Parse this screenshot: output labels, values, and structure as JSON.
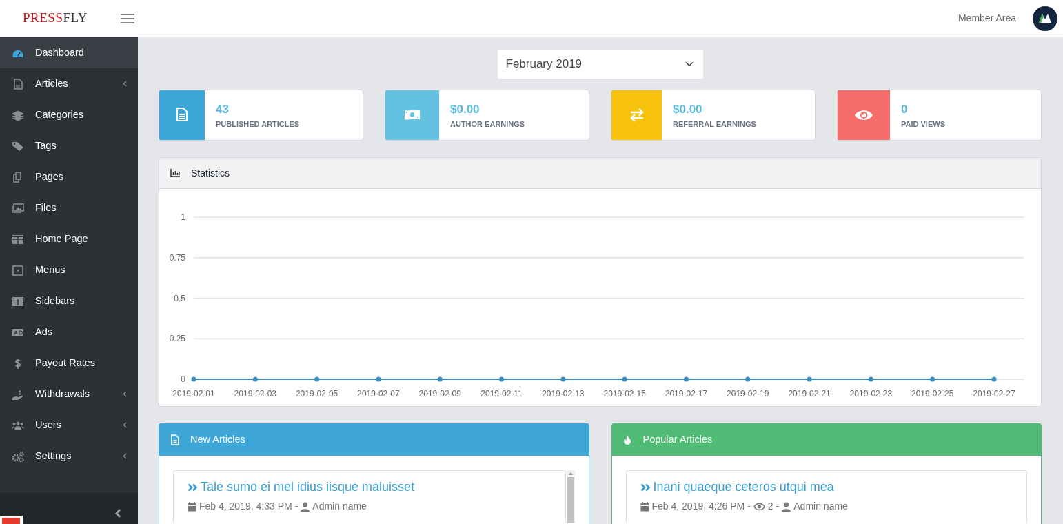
{
  "topbar": {
    "logo": {
      "part_1": "PRESS",
      "part_2": "FLY"
    },
    "member_link": "Member Area"
  },
  "sidebar": {
    "items": [
      {
        "label": "Dashboard",
        "selected": true,
        "has_submenu": false
      },
      {
        "label": "Articles",
        "selected": false,
        "has_submenu": true
      },
      {
        "label": "Categories",
        "selected": false,
        "has_submenu": false
      },
      {
        "label": "Tags",
        "selected": false,
        "has_submenu": false
      },
      {
        "label": "Pages",
        "selected": false,
        "has_submenu": false
      },
      {
        "label": "Files",
        "selected": false,
        "has_submenu": false
      },
      {
        "label": "Home Page",
        "selected": false,
        "has_submenu": false
      },
      {
        "label": "Menus",
        "selected": false,
        "has_submenu": false
      },
      {
        "label": "Sidebars",
        "selected": false,
        "has_submenu": false
      },
      {
        "label": "Ads",
        "selected": false,
        "has_submenu": false
      },
      {
        "label": "Payout Rates",
        "selected": false,
        "has_submenu": false
      },
      {
        "label": "Withdrawals",
        "selected": false,
        "has_submenu": true
      },
      {
        "label": "Users",
        "selected": false,
        "has_submenu": true
      },
      {
        "label": "Settings",
        "selected": false,
        "has_submenu": true
      }
    ]
  },
  "month_select": {
    "value": "February 2019"
  },
  "info_boxes": [
    {
      "value": "43",
      "label": "PUBLISHED ARTICLES",
      "color": "#3ca6d8"
    },
    {
      "value": "$0.00",
      "label": "AUTHOR EARNINGS",
      "color": "#62c2e0"
    },
    {
      "value": "$0.00",
      "label": "REFERRAL EARNINGS",
      "color": "#f6c20a"
    },
    {
      "value": "0",
      "label": "PAID VIEWS",
      "color": "#f66d6c"
    }
  ],
  "statistics": {
    "title": "Statistics",
    "chart_data": {
      "type": "line",
      "categories": [
        "2019-02-01",
        "2019-02-03",
        "2019-02-05",
        "2019-02-07",
        "2019-02-09",
        "2019-02-11",
        "2019-02-13",
        "2019-02-15",
        "2019-02-17",
        "2019-02-19",
        "2019-02-21",
        "2019-02-23",
        "2019-02-25",
        "2019-02-27"
      ],
      "grid": true,
      "series": [
        {
          "color": "#3c8dbc",
          "marker": true,
          "values": [
            0,
            0,
            0,
            0,
            0,
            0,
            0,
            0,
            0,
            0,
            0,
            0,
            0,
            0
          ]
        }
      ],
      "ylim": [
        0,
        1
      ],
      "yticks": [
        0,
        0.25,
        0.5,
        0.75,
        1
      ]
    }
  },
  "panels": [
    {
      "title": "New Articles",
      "color": "#3ea7d8",
      "articles": [
        {
          "title": "Tale sumo ei mel idius iisque maluisset",
          "date": "Feb 4, 2019, 4:33 PM",
          "separators": [
            "-"
          ],
          "author": "Admin name"
        }
      ]
    },
    {
      "title": "Popular Articles",
      "color": "#50bb74",
      "articles": [
        {
          "title": "Inani quaeque ceteros utqui mea",
          "date": "Feb 4, 2019, 4:26 PM",
          "views": "2",
          "separators": [
            "-",
            "-"
          ],
          "author": "Admin name"
        }
      ]
    }
  ]
}
